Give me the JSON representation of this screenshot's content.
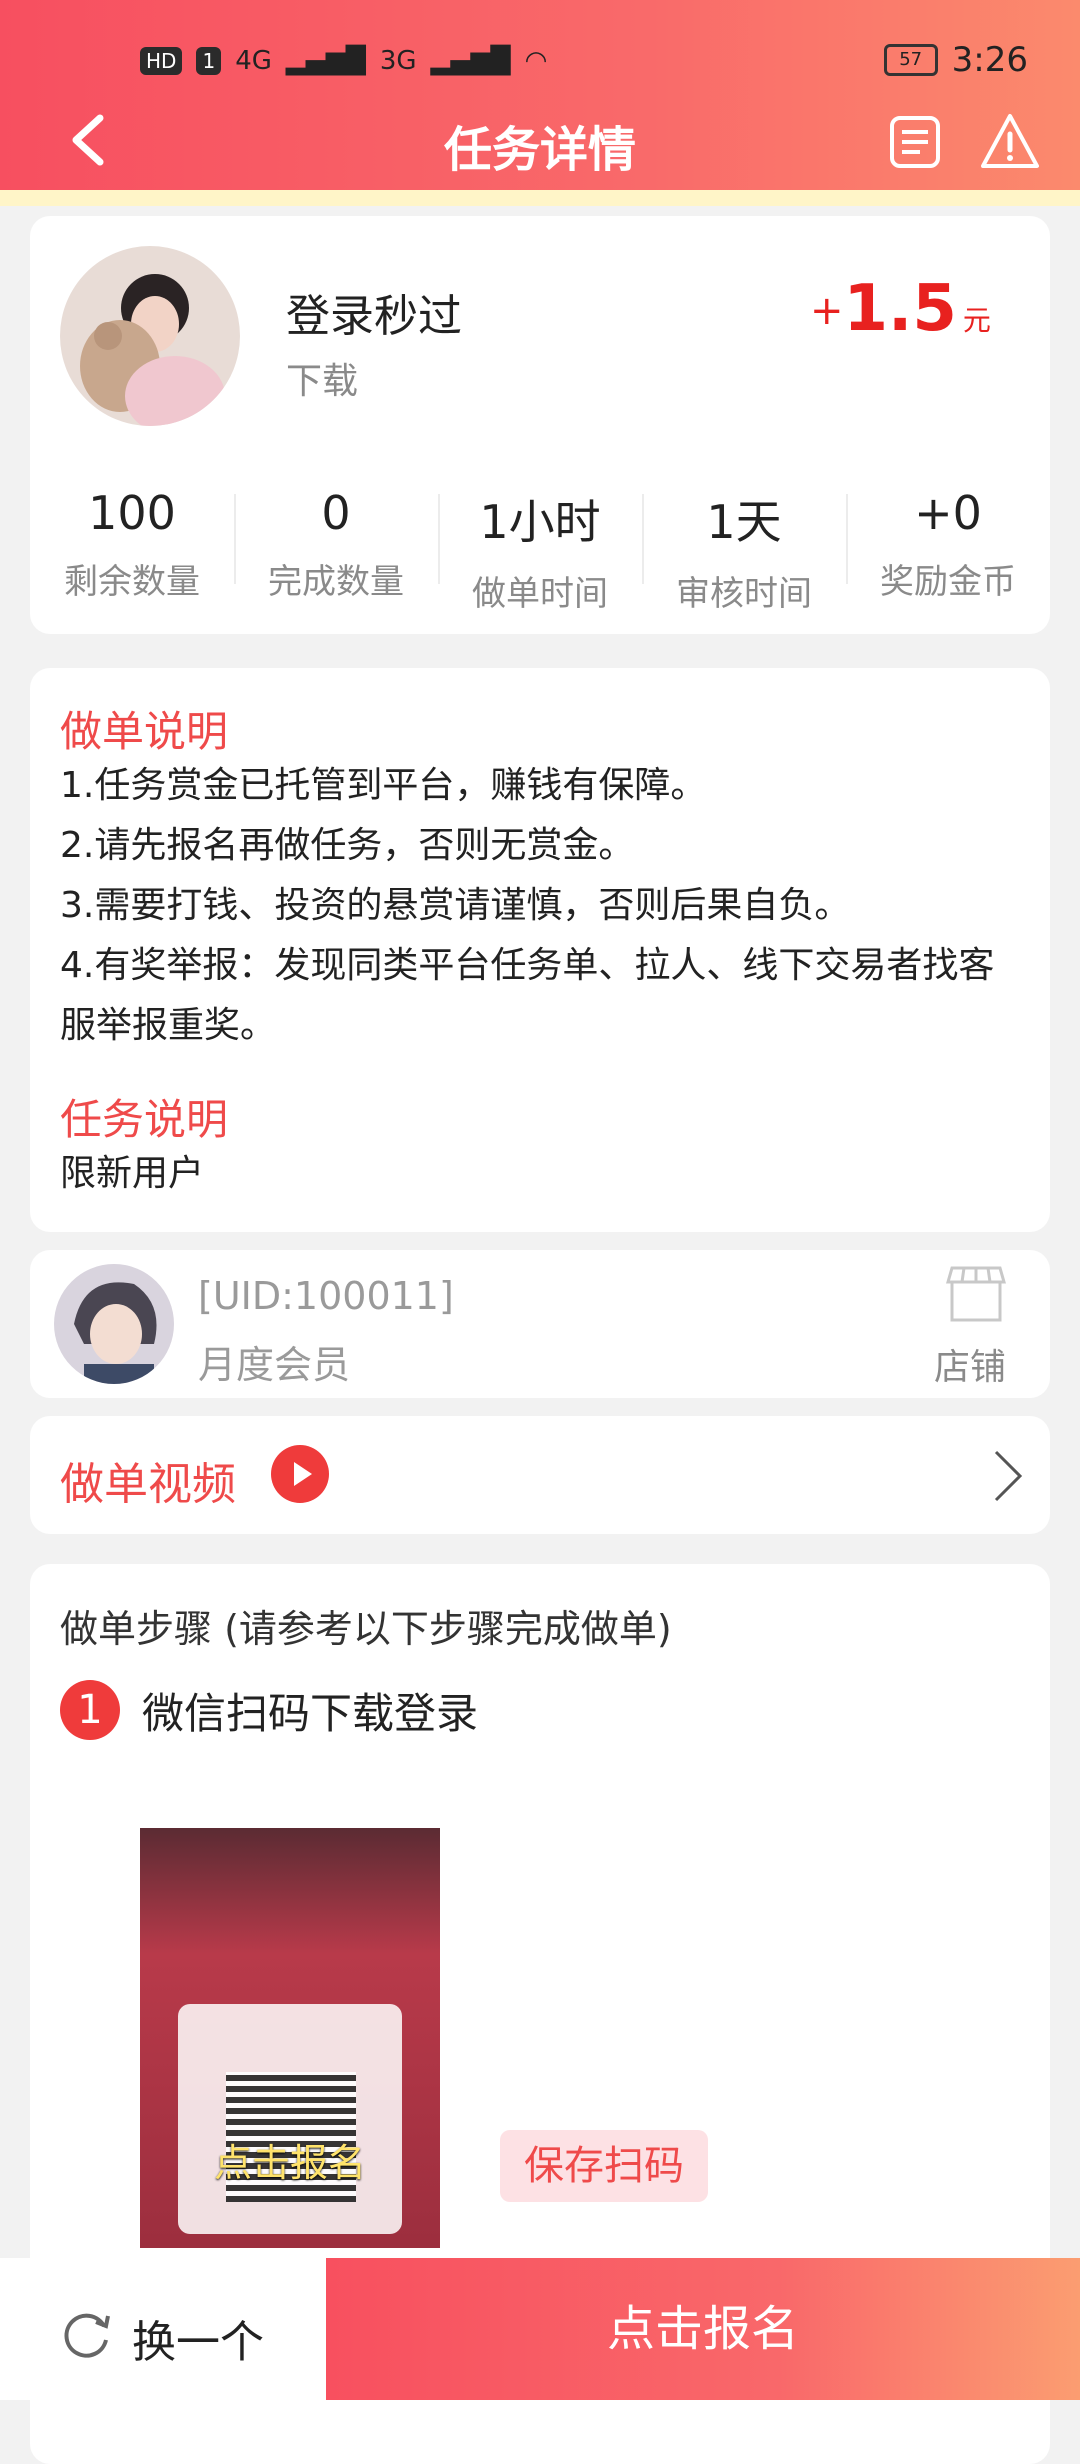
{
  "status_bar": {
    "hd_badge": "HD",
    "sim_badge": "1",
    "signal1": "4G",
    "signal2": "3G",
    "battery": "57",
    "time": "3:26"
  },
  "nav": {
    "title": "任务详情"
  },
  "task": {
    "title": "登录秒过",
    "subtitle": "下载",
    "reward_plus": "+",
    "reward_amount": "1.5",
    "reward_unit": "元",
    "stats": [
      {
        "value": "100",
        "label": "剩余数量"
      },
      {
        "value": "0",
        "label": "完成数量"
      },
      {
        "value": "1小时",
        "label": "做单时间"
      },
      {
        "value": "1天",
        "label": "审核时间"
      },
      {
        "value": "+0",
        "label": "奖励金币"
      }
    ]
  },
  "instructions": {
    "heading": "做单说明",
    "rules": [
      "1.任务赏金已托管到平台，赚钱有保障。",
      "2.请先报名再做任务，否则无赏金。",
      "3.需要打钱、投资的悬赏请谨慎，否则后果自负。",
      "4.有奖举报：发现同类平台任务单、拉人、线下交易者找客服举报重奖。"
    ],
    "task_heading": "任务说明",
    "task_desc": "限新用户"
  },
  "publisher": {
    "uid": "[UID:100011]",
    "membership": "月度会员",
    "store_label": "店铺"
  },
  "video": {
    "label": "做单视频"
  },
  "steps": {
    "heading": "做单步骤 (请参考以下步骤完成做单)",
    "items": [
      {
        "number": "1",
        "text": "微信扫码下载登录"
      }
    ],
    "screenshot_overlay": "点击报名",
    "save_button": "保存扫码"
  },
  "bottom_bar": {
    "switch_label": "换一个",
    "apply_label": "点击报名"
  },
  "colors": {
    "accent": "#ef4a4a",
    "reward": "#e8211f",
    "header_start": "#f74f60",
    "header_end": "#fb8a6d"
  }
}
